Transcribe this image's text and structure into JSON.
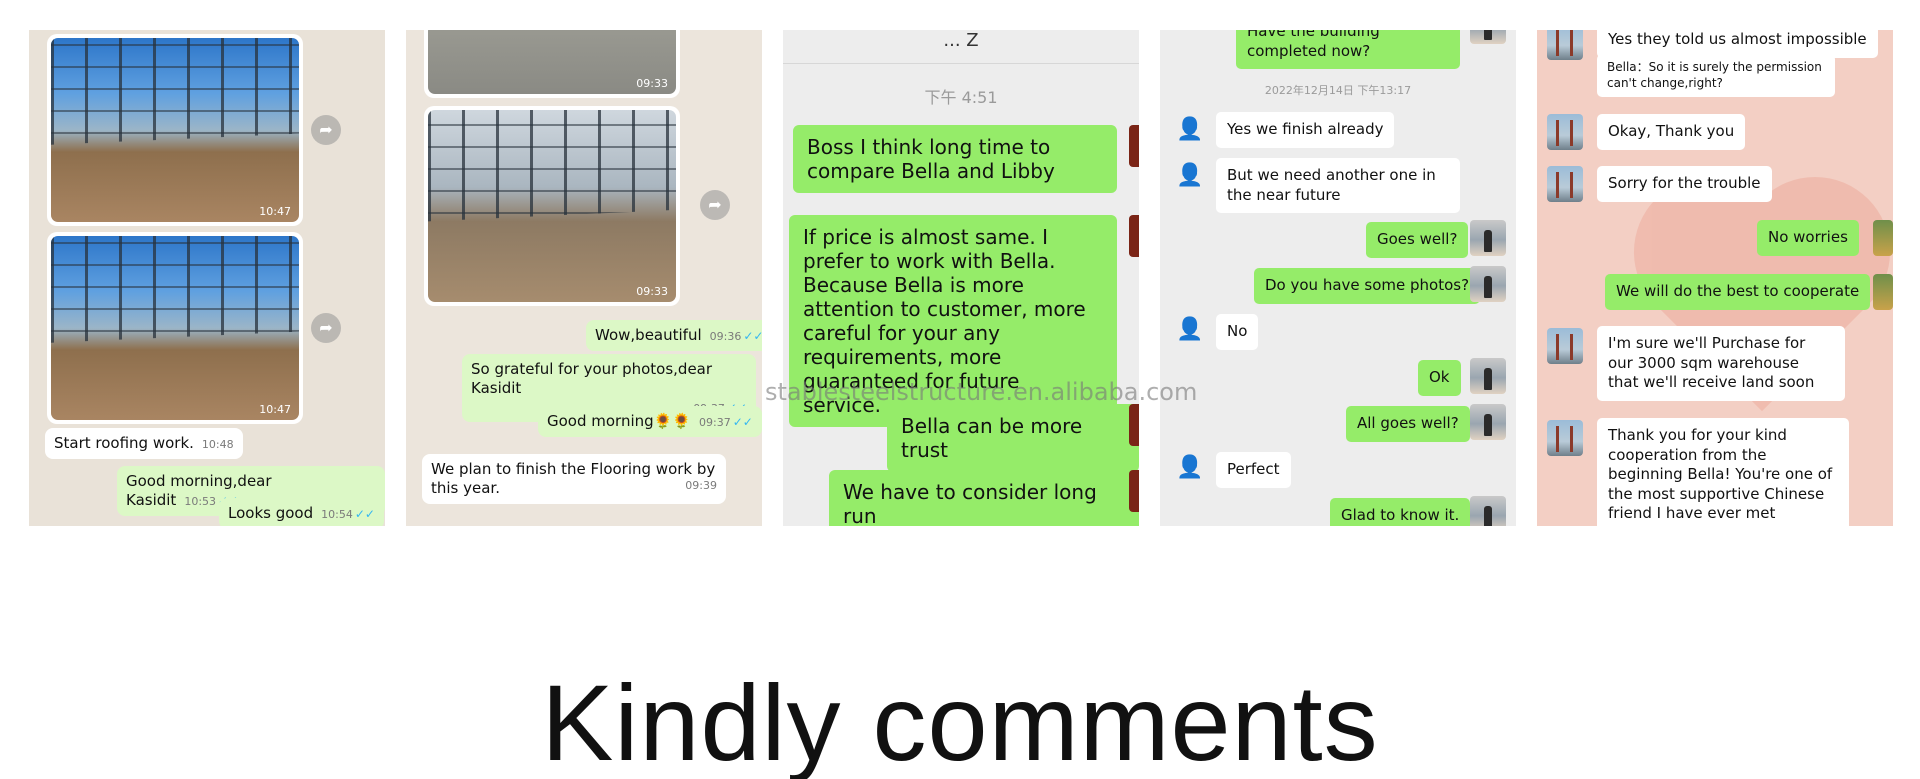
{
  "page_title": "Kindly comments",
  "watermark": "stablesteelstructure.en.alibaba.com",
  "panel1": {
    "photo_time_1": "10:47",
    "photo_time_2": "10:47",
    "msg1": {
      "text": "Start roofing work.",
      "time": "10:48"
    },
    "msg2": {
      "text": "Good morning,dear Kasidit",
      "time": "10:53"
    },
    "msg3": {
      "text": "Looks good",
      "time": "10:54"
    }
  },
  "panel2": {
    "photo_time_1": "09:33",
    "photo_time_2": "09:33",
    "msg1": {
      "text": "Wow,beautiful",
      "time": "09:36"
    },
    "msg2": {
      "text": "So grateful for your photos,dear Kasidit",
      "time": "09:37"
    },
    "msg3": {
      "text": "Good morning🌻🌻",
      "time": "09:37"
    },
    "msg4": {
      "text": "We plan to finish the Flooring work by this year.",
      "time": "09:39"
    }
  },
  "panel3": {
    "header": "... Z",
    "time": "下午 4:51",
    "msg1": "Boss I think long time to compare Bella and Libby",
    "msg2": "If price is almost same. I prefer to work with Bella. Because Bella is more attention to customer, more careful for your any requirements, more guaranteed for future service.",
    "msg3": "Bella can be more trust",
    "msg4": "We have to consider long run"
  },
  "panel4": {
    "top_msg": "Have the building completed now?",
    "time": "2022年12月14日 下午13:17",
    "messages": [
      {
        "text": "Yes we finish already"
      },
      {
        "text": "But we need another one in the near future"
      },
      {
        "text": "Goes well?"
      },
      {
        "text": "Do you have some photos?"
      },
      {
        "text": "No"
      },
      {
        "text": "Ok"
      },
      {
        "text": "All goes well?"
      },
      {
        "text": "Perfect"
      },
      {
        "text": "Glad to know it."
      }
    ]
  },
  "panel5": {
    "messages": [
      {
        "text": "Yes they told us almost impossible"
      },
      {
        "text": "Bella：So it is surely the permission can't change,right?"
      },
      {
        "text": "Okay, Thank you"
      },
      {
        "text": "Sorry for the trouble"
      },
      {
        "text": "No worries"
      },
      {
        "text": "We will do the best to cooperate"
      },
      {
        "text": "I'm sure we'll Purchase for our 3000 sqm warehouse that we'll receive land soon"
      },
      {
        "text": "Thank you for your kind cooperation from the beginning Bella! You're one of the most supportive Chinese friend I have ever met"
      }
    ]
  },
  "icons": {
    "forward": "forward-icon",
    "read_ticks": "double-check-icon",
    "contact": "person-icon"
  }
}
